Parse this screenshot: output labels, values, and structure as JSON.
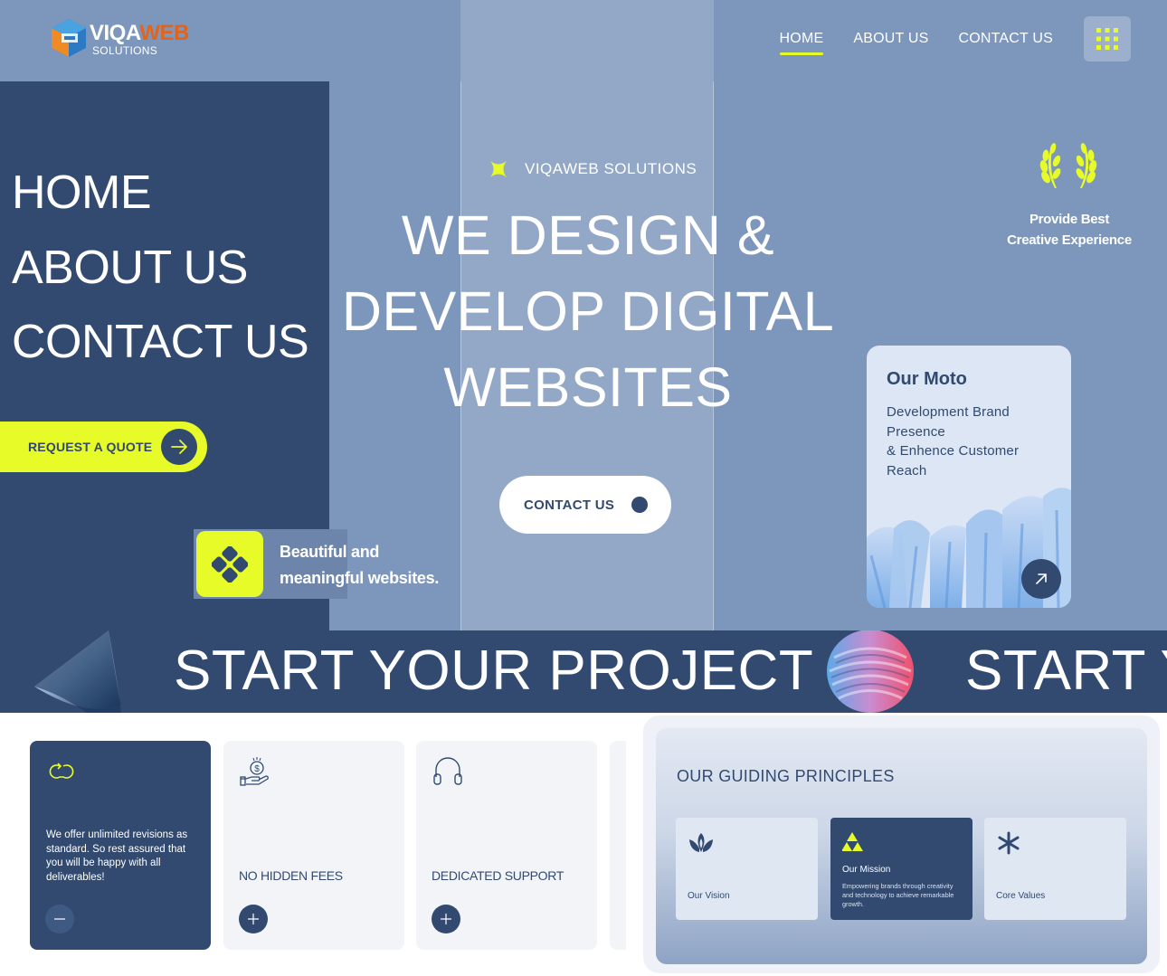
{
  "brand": {
    "name_part1": "VIQA",
    "name_part2": "WEB",
    "tagline": "SOLUTIONS",
    "colors": {
      "navy": "#324a70",
      "accent": "#e6fb27",
      "hero_bg": "#7d96bb",
      "logo_orange": "#e2641c"
    }
  },
  "nav": {
    "items": [
      {
        "label": "HOME",
        "active": true
      },
      {
        "label": "ABOUT US",
        "active": false
      },
      {
        "label": "CONTACT US",
        "active": false
      }
    ],
    "menu_icon": "grid-dots-icon"
  },
  "side_menu": {
    "items": [
      {
        "label": "HOME"
      },
      {
        "label": "ABOUT US"
      },
      {
        "label": "CONTACT US"
      }
    ],
    "quote_button": "REQUEST A QUOTE",
    "quote_icon": "arrow-right-icon"
  },
  "badge": {
    "text_line1": "Beautiful and",
    "text_line2": "meaningful websites.",
    "icon": "clover-icon"
  },
  "hero": {
    "eyebrow": "VIQAWEB SOLUTIONS",
    "eyebrow_icon": "star-x-icon",
    "headline_lines": [
      "WE DESIGN &",
      "DEVELOP DIGITAL",
      "WEBSITES"
    ],
    "cta_label": "CONTACT US"
  },
  "award": {
    "icon": "laurel-icon",
    "line1": "Provide Best",
    "line2": "Creative Experience"
  },
  "moto": {
    "title": "Our Moto",
    "body_lines": [
      "Development Brand",
      "Presence",
      "& Enhence Customer",
      "Reach"
    ],
    "arrow_icon": "arrow-up-right-icon"
  },
  "marquee": {
    "text1": "START YOUR PROJECT",
    "text2": "START Y"
  },
  "features": [
    {
      "icon": "refresh-loop-icon",
      "title": "",
      "description": "We offer unlimited revisions as standard. So rest assured that you will be happy with all deliverables!",
      "expanded": true,
      "button_icon": "minus-icon"
    },
    {
      "icon": "money-hand-icon",
      "title": "NO HIDDEN FEES",
      "description": "",
      "expanded": false,
      "button_icon": "plus-icon"
    },
    {
      "icon": "headphones-icon",
      "title": "DEDICATED SUPPORT",
      "description": "",
      "expanded": false,
      "button_icon": "plus-icon"
    }
  ],
  "principles": {
    "title": "OUR GUIDING PRINCIPLES",
    "cards": [
      {
        "icon": "lotus-icon",
        "label": "Our Vision",
        "description": ""
      },
      {
        "icon": "triangles-icon",
        "label": "Our Mission",
        "description": "Empowering brands through creativity and technology to achieve remarkable growth."
      },
      {
        "icon": "asterisk-icon",
        "label": "Core Values",
        "description": ""
      }
    ]
  }
}
